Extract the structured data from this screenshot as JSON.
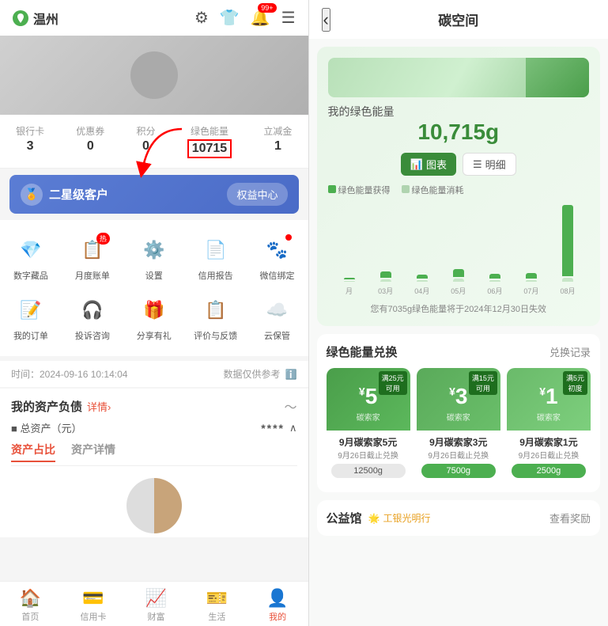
{
  "left": {
    "header": {
      "city": "温州",
      "icons": [
        "gear",
        "shirt",
        "notification",
        "menu"
      ],
      "notification_badge": "99+"
    },
    "stats": [
      {
        "label": "银行卡",
        "value": "3"
      },
      {
        "label": "优惠券",
        "value": "0"
      },
      {
        "label": "积分",
        "value": "0"
      },
      {
        "label": "绿色能量",
        "value": "10715"
      },
      {
        "label": "立减金",
        "value": "1"
      }
    ],
    "vip": {
      "label": "二星级客户",
      "btn": "权益中心"
    },
    "menu_items": [
      {
        "label": "数字藏品",
        "icon": "💎",
        "badge": ""
      },
      {
        "label": "月度账单",
        "icon": "📋",
        "badge": "热"
      },
      {
        "label": "设置",
        "icon": "⚙️",
        "badge": ""
      },
      {
        "label": "信用报告",
        "icon": "📄",
        "badge": ""
      },
      {
        "label": "微信绑定",
        "icon": "🐾",
        "badge": "dot"
      },
      {
        "label": "我的订单",
        "icon": "📝",
        "badge": ""
      },
      {
        "label": "投诉咨询",
        "icon": "🎧",
        "badge": ""
      },
      {
        "label": "分享有礼",
        "icon": "🎁",
        "badge": ""
      },
      {
        "label": "评价与反馈",
        "icon": "📋",
        "badge": ""
      },
      {
        "label": "云保管",
        "icon": "☁️",
        "badge": ""
      }
    ],
    "info_bar": {
      "time_label": "时间：2024-09-16 10:14:04",
      "data_note": "数据仅供参考"
    },
    "assets": {
      "title": "我的资产负债",
      "link": "详情›",
      "total_label": "■ 总资产（元）",
      "hidden": "****",
      "tabs": [
        "资产占比",
        "资产详情"
      ]
    },
    "bottom_nav": [
      {
        "label": "首页",
        "icon": "🏠",
        "active": false
      },
      {
        "label": "信用卡",
        "icon": "💳",
        "active": false
      },
      {
        "label": "财富",
        "icon": "📈",
        "active": false
      },
      {
        "label": "生活",
        "icon": "🎫",
        "active": false
      },
      {
        "label": "我的",
        "icon": "👤",
        "active": true
      }
    ]
  },
  "right": {
    "header": {
      "title": "碳空间",
      "back": "‹"
    },
    "energy": {
      "subtitle": "我的绿色能量",
      "value": "10,715g",
      "toggle": [
        "图表",
        "明细"
      ],
      "active_toggle": 0,
      "legend": [
        "绿色能量获得",
        "绿色能量消耗"
      ],
      "chart_data": [
        {
          "label": "月",
          "obtain": 2,
          "consume": 1
        },
        {
          "label": "03月",
          "obtain": 6,
          "consume": 2
        },
        {
          "label": "04月",
          "obtain": 4,
          "consume": 1
        },
        {
          "label": "05月",
          "obtain": 8,
          "consume": 3
        },
        {
          "label": "06月",
          "obtain": 5,
          "consume": 2
        },
        {
          "label": "07月",
          "obtain": 6,
          "consume": 1
        },
        {
          "label": "08月",
          "obtain": 90,
          "consume": 4
        }
      ],
      "note": "您有7035g绿色能量将于2024年12月30日失效"
    },
    "exchange": {
      "title": "绿色能量兑换",
      "link": "兑换记录",
      "cards": [
        {
          "price": "¥5",
          "name": "9月碳索家5元",
          "date": "9月26日截止兑换",
          "cost": "12500g",
          "cost_active": false,
          "ribbon": "满25元\n可用"
        },
        {
          "price": "¥3",
          "name": "9月碳索家3元",
          "date": "9月26日截止兑换",
          "cost": "7500g",
          "cost_active": true,
          "ribbon": "满15元\n可用"
        },
        {
          "price": "¥1",
          "name": "9月碳索家1元",
          "date": "9月26日截止兑换",
          "cost": "2500g",
          "cost_active": true,
          "ribbon": "满5元\n初度"
        }
      ]
    },
    "charity": {
      "title": "公益馆",
      "brand": "工银光明行",
      "link": "查看奖励"
    }
  }
}
